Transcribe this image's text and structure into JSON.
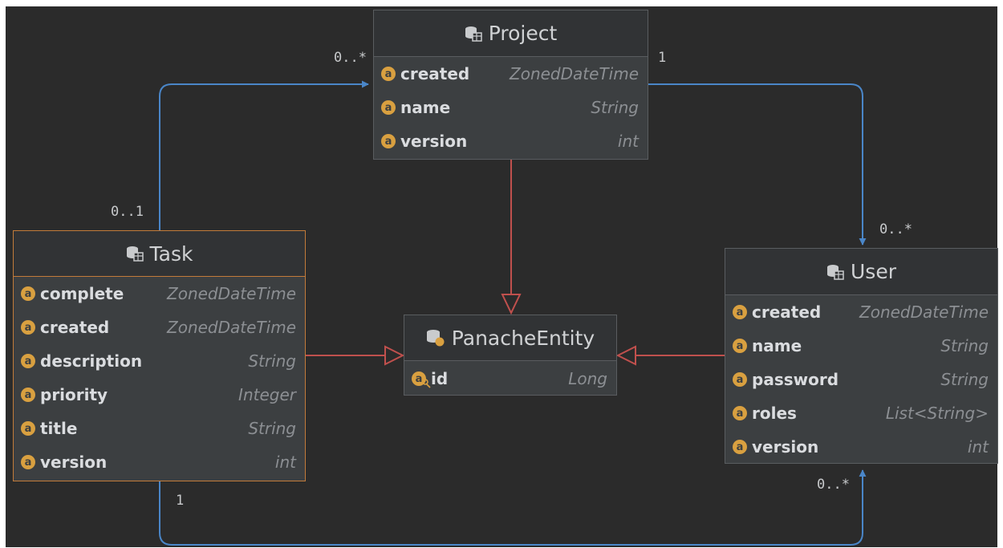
{
  "colors": {
    "background": "#2b2b2b",
    "association": "#4a86c8",
    "inheritance": "#c0504d",
    "attribute_icon": "#d9a040",
    "selected_border": "#c27b3a"
  },
  "entities": {
    "project": {
      "name": "Project",
      "icon": "database-table-icon",
      "fields": [
        {
          "name": "created",
          "type": "ZonedDateTime"
        },
        {
          "name": "name",
          "type": "String"
        },
        {
          "name": "version",
          "type": "int"
        }
      ]
    },
    "task": {
      "name": "Task",
      "icon": "database-table-icon",
      "selected": true,
      "fields": [
        {
          "name": "complete",
          "type": "ZonedDateTime"
        },
        {
          "name": "created",
          "type": "ZonedDateTime"
        },
        {
          "name": "description",
          "type": "String"
        },
        {
          "name": "priority",
          "type": "Integer"
        },
        {
          "name": "title",
          "type": "String"
        },
        {
          "name": "version",
          "type": "int"
        }
      ]
    },
    "panache": {
      "name": "PanacheEntity",
      "icon": "database-table-icon",
      "fields": [
        {
          "name": "id",
          "type": "Long",
          "icon": "key-attribute-icon"
        }
      ]
    },
    "user": {
      "name": "User",
      "icon": "database-table-icon",
      "fields": [
        {
          "name": "created",
          "type": "ZonedDateTime"
        },
        {
          "name": "name",
          "type": "String"
        },
        {
          "name": "password",
          "type": "String"
        },
        {
          "name": "roles",
          "type": "List<String>"
        },
        {
          "name": "version",
          "type": "int"
        }
      ]
    }
  },
  "multiplicities": {
    "task_to_project_project_end": "0..*",
    "task_to_project_task_end": "0..1",
    "project_to_user_project_end": "1",
    "project_to_user_user_end": "0..*",
    "task_to_user_task_end": "1",
    "task_to_user_user_end": "0..*"
  }
}
